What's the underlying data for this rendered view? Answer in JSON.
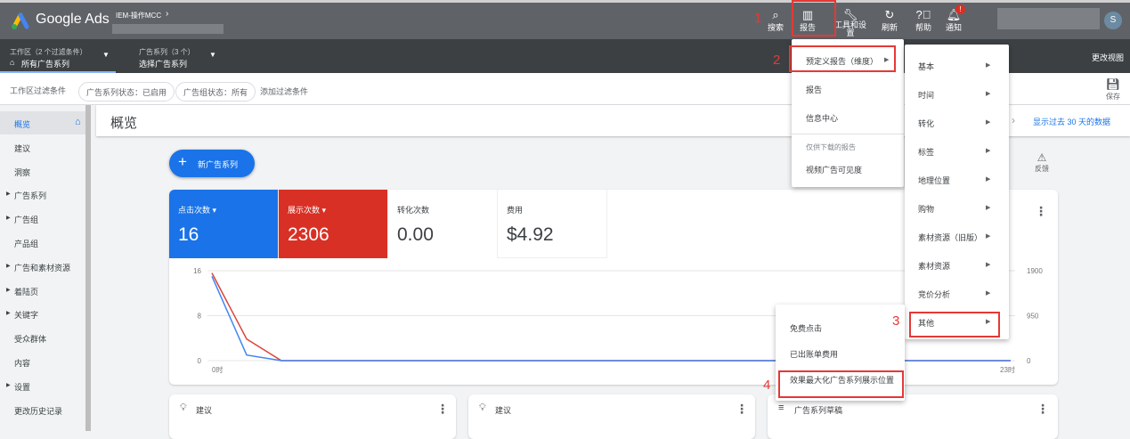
{
  "header": {
    "app_name": "Google Ads",
    "account": "IEM-操作MCC",
    "avatar_letter": "S",
    "tools": [
      {
        "icon": "search-icon",
        "label": "搜索"
      },
      {
        "icon": "reports-icon",
        "label": "报告"
      },
      {
        "icon": "wrench-icon",
        "label": "工具和设置"
      },
      {
        "icon": "refresh-icon",
        "label": "刷新"
      },
      {
        "icon": "help-icon",
        "label": "帮助"
      },
      {
        "icon": "bell-icon",
        "label": "通知"
      }
    ]
  },
  "workspace": {
    "label": "工作区（2 个过滤条件）",
    "value": "所有广告系列",
    "campaigns_label": "广告系列（3 个）",
    "campaigns_value": "选择广告系列",
    "change_view": "更改视图"
  },
  "filters": {
    "label": "工作区过滤条件",
    "chips": [
      "广告系列状态：已启用",
      "广告组状态：所有"
    ],
    "add": "添加过滤条件",
    "save": "保存"
  },
  "sidebar": {
    "items": [
      {
        "label": "概览",
        "expand": false
      },
      {
        "label": "建议",
        "expand": false
      },
      {
        "label": "洞察",
        "expand": false
      },
      {
        "label": "广告系列",
        "expand": true
      },
      {
        "label": "广告组",
        "expand": true
      },
      {
        "label": "产品组",
        "expand": false
      },
      {
        "label": "广告和素材资源",
        "expand": true
      },
      {
        "label": "着陆页",
        "expand": true
      },
      {
        "label": "关键字",
        "expand": true
      },
      {
        "label": "受众群体",
        "expand": false
      },
      {
        "label": "内容",
        "expand": false
      },
      {
        "label": "设置",
        "expand": true
      },
      {
        "label": "更改历史记录",
        "expand": false
      }
    ]
  },
  "main": {
    "title": "概览",
    "date_range": "显示过去 30 天的数据",
    "new_campaign": "新广告系列",
    "feedback": "反馈",
    "metrics": [
      {
        "label": "点击次数",
        "value": "16",
        "color": "#1a73e8"
      },
      {
        "label": "展示次数",
        "value": "2306",
        "color": "#d93025"
      },
      {
        "label": "转化次数",
        "value": "0.00"
      },
      {
        "label": "费用",
        "value": "$4.92"
      }
    ],
    "cards": [
      "建议",
      "建议",
      "广告系列草稿"
    ]
  },
  "chart_data": {
    "type": "line",
    "x": [
      0,
      1,
      2,
      3,
      4,
      5,
      6,
      7,
      8,
      9,
      10,
      11,
      12,
      13,
      14,
      15,
      16,
      17,
      18,
      19,
      20,
      21,
      22,
      23
    ],
    "xtick_labels": [
      "0时",
      "23时"
    ],
    "left_ticks": [
      "16",
      "8",
      "0"
    ],
    "right_ticks": [
      "1900",
      "950",
      "0"
    ],
    "ylim_left": [
      0,
      16
    ],
    "ylim_right": [
      0,
      1900
    ],
    "series": [
      {
        "name": "点击次数",
        "axis": "left",
        "color": "#4285f4",
        "values": [
          15,
          1,
          0,
          0,
          0,
          0,
          0,
          0,
          0,
          0,
          0,
          0,
          0,
          0,
          0,
          0,
          0,
          0,
          0,
          0,
          0,
          0,
          0,
          0
        ]
      },
      {
        "name": "展示次数",
        "axis": "right",
        "color": "#db4437",
        "values": [
          1850,
          456,
          0,
          0,
          0,
          0,
          0,
          0,
          0,
          0,
          0,
          0,
          0,
          0,
          0,
          0,
          0,
          0,
          0,
          0,
          0,
          0,
          0,
          0
        ]
      }
    ]
  },
  "menus": {
    "reports": {
      "items": [
        "预定义报告（维度）",
        "报告",
        "信息中心"
      ],
      "section": "仅供下载的报告",
      "section_items": [
        "视频广告可见度"
      ]
    },
    "predefined": [
      "基本",
      "时间",
      "转化",
      "标签",
      "地理位置",
      "购物",
      "素材资源（旧版）",
      "素材资源",
      "竞价分析",
      "其他"
    ],
    "other": [
      "免费点击",
      "已出账单费用",
      "效果最大化广告系列展示位置"
    ]
  },
  "steps": [
    "1",
    "2",
    "3",
    "4"
  ]
}
